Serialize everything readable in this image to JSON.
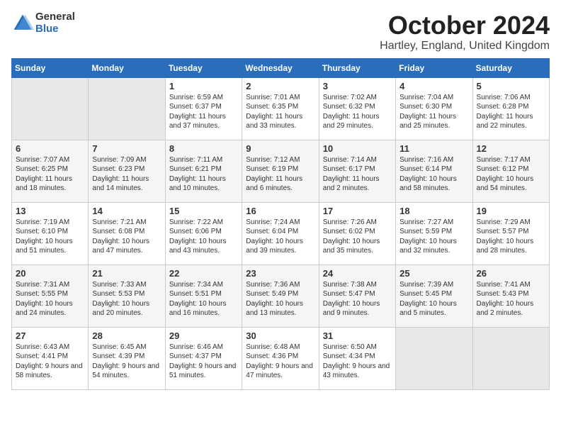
{
  "logo": {
    "general": "General",
    "blue": "Blue"
  },
  "title": "October 2024",
  "location": "Hartley, England, United Kingdom",
  "days_of_week": [
    "Sunday",
    "Monday",
    "Tuesday",
    "Wednesday",
    "Thursday",
    "Friday",
    "Saturday"
  ],
  "weeks": [
    [
      {
        "day": "",
        "empty": true
      },
      {
        "day": "",
        "empty": true
      },
      {
        "day": "1",
        "sunrise": "Sunrise: 6:59 AM",
        "sunset": "Sunset: 6:37 PM",
        "daylight": "Daylight: 11 hours and 37 minutes."
      },
      {
        "day": "2",
        "sunrise": "Sunrise: 7:01 AM",
        "sunset": "Sunset: 6:35 PM",
        "daylight": "Daylight: 11 hours and 33 minutes."
      },
      {
        "day": "3",
        "sunrise": "Sunrise: 7:02 AM",
        "sunset": "Sunset: 6:32 PM",
        "daylight": "Daylight: 11 hours and 29 minutes."
      },
      {
        "day": "4",
        "sunrise": "Sunrise: 7:04 AM",
        "sunset": "Sunset: 6:30 PM",
        "daylight": "Daylight: 11 hours and 25 minutes."
      },
      {
        "day": "5",
        "sunrise": "Sunrise: 7:06 AM",
        "sunset": "Sunset: 6:28 PM",
        "daylight": "Daylight: 11 hours and 22 minutes."
      }
    ],
    [
      {
        "day": "6",
        "sunrise": "Sunrise: 7:07 AM",
        "sunset": "Sunset: 6:25 PM",
        "daylight": "Daylight: 11 hours and 18 minutes."
      },
      {
        "day": "7",
        "sunrise": "Sunrise: 7:09 AM",
        "sunset": "Sunset: 6:23 PM",
        "daylight": "Daylight: 11 hours and 14 minutes."
      },
      {
        "day": "8",
        "sunrise": "Sunrise: 7:11 AM",
        "sunset": "Sunset: 6:21 PM",
        "daylight": "Daylight: 11 hours and 10 minutes."
      },
      {
        "day": "9",
        "sunrise": "Sunrise: 7:12 AM",
        "sunset": "Sunset: 6:19 PM",
        "daylight": "Daylight: 11 hours and 6 minutes."
      },
      {
        "day": "10",
        "sunrise": "Sunrise: 7:14 AM",
        "sunset": "Sunset: 6:17 PM",
        "daylight": "Daylight: 11 hours and 2 minutes."
      },
      {
        "day": "11",
        "sunrise": "Sunrise: 7:16 AM",
        "sunset": "Sunset: 6:14 PM",
        "daylight": "Daylight: 10 hours and 58 minutes."
      },
      {
        "day": "12",
        "sunrise": "Sunrise: 7:17 AM",
        "sunset": "Sunset: 6:12 PM",
        "daylight": "Daylight: 10 hours and 54 minutes."
      }
    ],
    [
      {
        "day": "13",
        "sunrise": "Sunrise: 7:19 AM",
        "sunset": "Sunset: 6:10 PM",
        "daylight": "Daylight: 10 hours and 51 minutes."
      },
      {
        "day": "14",
        "sunrise": "Sunrise: 7:21 AM",
        "sunset": "Sunset: 6:08 PM",
        "daylight": "Daylight: 10 hours and 47 minutes."
      },
      {
        "day": "15",
        "sunrise": "Sunrise: 7:22 AM",
        "sunset": "Sunset: 6:06 PM",
        "daylight": "Daylight: 10 hours and 43 minutes."
      },
      {
        "day": "16",
        "sunrise": "Sunrise: 7:24 AM",
        "sunset": "Sunset: 6:04 PM",
        "daylight": "Daylight: 10 hours and 39 minutes."
      },
      {
        "day": "17",
        "sunrise": "Sunrise: 7:26 AM",
        "sunset": "Sunset: 6:02 PM",
        "daylight": "Daylight: 10 hours and 35 minutes."
      },
      {
        "day": "18",
        "sunrise": "Sunrise: 7:27 AM",
        "sunset": "Sunset: 5:59 PM",
        "daylight": "Daylight: 10 hours and 32 minutes."
      },
      {
        "day": "19",
        "sunrise": "Sunrise: 7:29 AM",
        "sunset": "Sunset: 5:57 PM",
        "daylight": "Daylight: 10 hours and 28 minutes."
      }
    ],
    [
      {
        "day": "20",
        "sunrise": "Sunrise: 7:31 AM",
        "sunset": "Sunset: 5:55 PM",
        "daylight": "Daylight: 10 hours and 24 minutes."
      },
      {
        "day": "21",
        "sunrise": "Sunrise: 7:33 AM",
        "sunset": "Sunset: 5:53 PM",
        "daylight": "Daylight: 10 hours and 20 minutes."
      },
      {
        "day": "22",
        "sunrise": "Sunrise: 7:34 AM",
        "sunset": "Sunset: 5:51 PM",
        "daylight": "Daylight: 10 hours and 16 minutes."
      },
      {
        "day": "23",
        "sunrise": "Sunrise: 7:36 AM",
        "sunset": "Sunset: 5:49 PM",
        "daylight": "Daylight: 10 hours and 13 minutes."
      },
      {
        "day": "24",
        "sunrise": "Sunrise: 7:38 AM",
        "sunset": "Sunset: 5:47 PM",
        "daylight": "Daylight: 10 hours and 9 minutes."
      },
      {
        "day": "25",
        "sunrise": "Sunrise: 7:39 AM",
        "sunset": "Sunset: 5:45 PM",
        "daylight": "Daylight: 10 hours and 5 minutes."
      },
      {
        "day": "26",
        "sunrise": "Sunrise: 7:41 AM",
        "sunset": "Sunset: 5:43 PM",
        "daylight": "Daylight: 10 hours and 2 minutes."
      }
    ],
    [
      {
        "day": "27",
        "sunrise": "Sunrise: 6:43 AM",
        "sunset": "Sunset: 4:41 PM",
        "daylight": "Daylight: 9 hours and 58 minutes."
      },
      {
        "day": "28",
        "sunrise": "Sunrise: 6:45 AM",
        "sunset": "Sunset: 4:39 PM",
        "daylight": "Daylight: 9 hours and 54 minutes."
      },
      {
        "day": "29",
        "sunrise": "Sunrise: 6:46 AM",
        "sunset": "Sunset: 4:37 PM",
        "daylight": "Daylight: 9 hours and 51 minutes."
      },
      {
        "day": "30",
        "sunrise": "Sunrise: 6:48 AM",
        "sunset": "Sunset: 4:36 PM",
        "daylight": "Daylight: 9 hours and 47 minutes."
      },
      {
        "day": "31",
        "sunrise": "Sunrise: 6:50 AM",
        "sunset": "Sunset: 4:34 PM",
        "daylight": "Daylight: 9 hours and 43 minutes."
      },
      {
        "day": "",
        "empty": true
      },
      {
        "day": "",
        "empty": true
      }
    ]
  ]
}
